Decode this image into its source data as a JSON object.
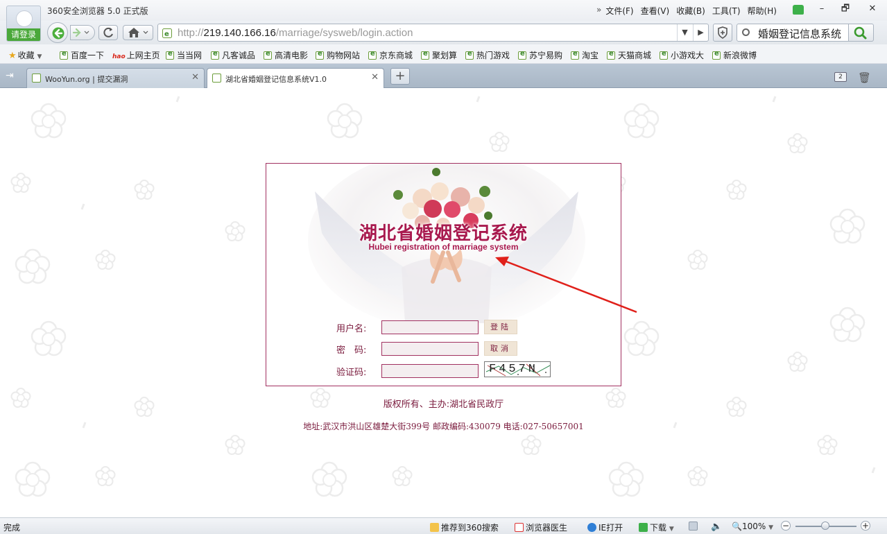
{
  "window": {
    "app_title": "360安全浏览器 5.0 正式版",
    "login_label": "请登录",
    "menu": [
      "文件(F)",
      "查看(V)",
      "收藏(B)",
      "工具(T)",
      "帮助(H)"
    ],
    "minimize": "–",
    "restore": "🗗",
    "close": "✕"
  },
  "nav": {
    "url_prefix": "http://",
    "url_host": "219.140.166.16",
    "url_path": "/marriage/sysweb/login.action",
    "search_query": "婚姻登记信息系统",
    "dropdown": "▼",
    "go": "▶"
  },
  "bookmarks": [
    "收藏",
    "百度一下",
    "上网主页",
    "当当网",
    "凡客诚品",
    "高清电影",
    "购物网站",
    "京东商城",
    "聚划算",
    "热门游戏",
    "苏宁易购",
    "淘宝",
    "天猫商城",
    "小游戏大",
    "新浪微博"
  ],
  "bookmark_logo_hao": "hao",
  "tabs": [
    {
      "title": "WooYun.org | 提交漏洞",
      "active": false
    },
    {
      "title": "湖北省婚姻登记信息系统V1.0",
      "active": true
    }
  ],
  "tab_close": "✕",
  "new_tab": "+",
  "tab_count": "2",
  "login": {
    "title": "湖北省婚姻登记系统",
    "subtitle": "Hubei  registration of marriage system",
    "username_label": "用户名:",
    "password_label": "密　码:",
    "captcha_label": "验证码:",
    "login_button": "登陆",
    "cancel_button": "取消",
    "captcha_text": "F457N"
  },
  "footer": {
    "copyright": "版权所有、主办:湖北省民政厅",
    "address": "地址:武汉市洪山区雄楚大街399号  邮政编码:430079 电话:027-50657001"
  },
  "status": {
    "left": "完成",
    "recommend": "推荐到360搜索",
    "doctor": "浏览器医生",
    "ie_open": "IE打开",
    "download": "下载",
    "zoom": "100%",
    "zoom_level_percent": 100
  },
  "colors": {
    "accent_maroon": "#a8194e",
    "annotation_arrow": "#e0201a",
    "browser_green": "#4aa83a"
  }
}
